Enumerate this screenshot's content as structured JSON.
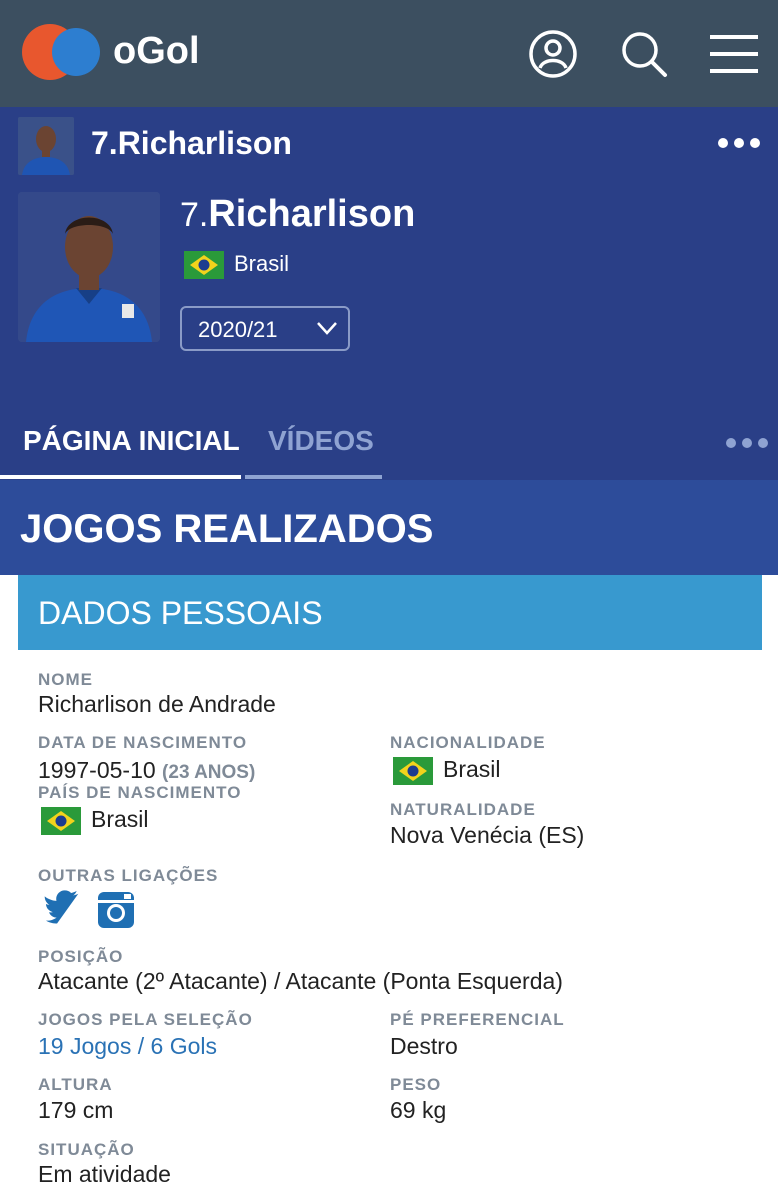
{
  "appbar": {
    "brand": "oGol",
    "icons": [
      "user-icon",
      "search-icon",
      "menu-icon"
    ]
  },
  "player": {
    "mini_title": "7.Richarlison",
    "number": "7.",
    "name": "Richarlison",
    "country": "Brasil",
    "season": "2020/21"
  },
  "tabs": [
    {
      "label": "PÁGINA INICIAL"
    },
    {
      "label": "VÍDEOS"
    }
  ],
  "section_title": "JOGOS REALIZADOS",
  "panel_title": "DADOS PESSOAIS",
  "fields": {
    "nome": {
      "label": "NOME",
      "value": "Richarlison de Andrade"
    },
    "data_nascimento": {
      "label": "DATA DE NASCIMENTO",
      "value": "1997-05-10",
      "age": "(23 ANOS)"
    },
    "nacionalidade": {
      "label": "NACIONALIDADE",
      "value": "Brasil"
    },
    "pais_nascimento": {
      "label": "PAÍS DE NASCIMENTO",
      "value": "Brasil"
    },
    "naturalidade": {
      "label": "NATURALIDADE",
      "value": "Nova Venécia (ES)"
    },
    "outras_ligacoes": {
      "label": "OUTRAS LIGAÇÕES"
    },
    "posicao": {
      "label": "POSIÇÃO",
      "value": "Atacante (2º Atacante) / Atacante (Ponta Esquerda)"
    },
    "jogos_selecao": {
      "label": "JOGOS PELA SELEÇÃO",
      "value": "19 Jogos / 6 Gols"
    },
    "pe_preferencial": {
      "label": "PÉ PREFERENCIAL",
      "value": "Destro"
    },
    "altura": {
      "label": "ALTURA",
      "value": "179 cm"
    },
    "peso": {
      "label": "PESO",
      "value": "69 kg"
    },
    "situacao": {
      "label": "SITUAÇÃO",
      "value": "Em atividade"
    }
  },
  "colors": {
    "appbar": "#3c4f60",
    "header": "#2a3f87",
    "section": "#2d4c9a",
    "panel": "#3899cf",
    "link": "#2a72b5",
    "label": "#7f8a97"
  }
}
